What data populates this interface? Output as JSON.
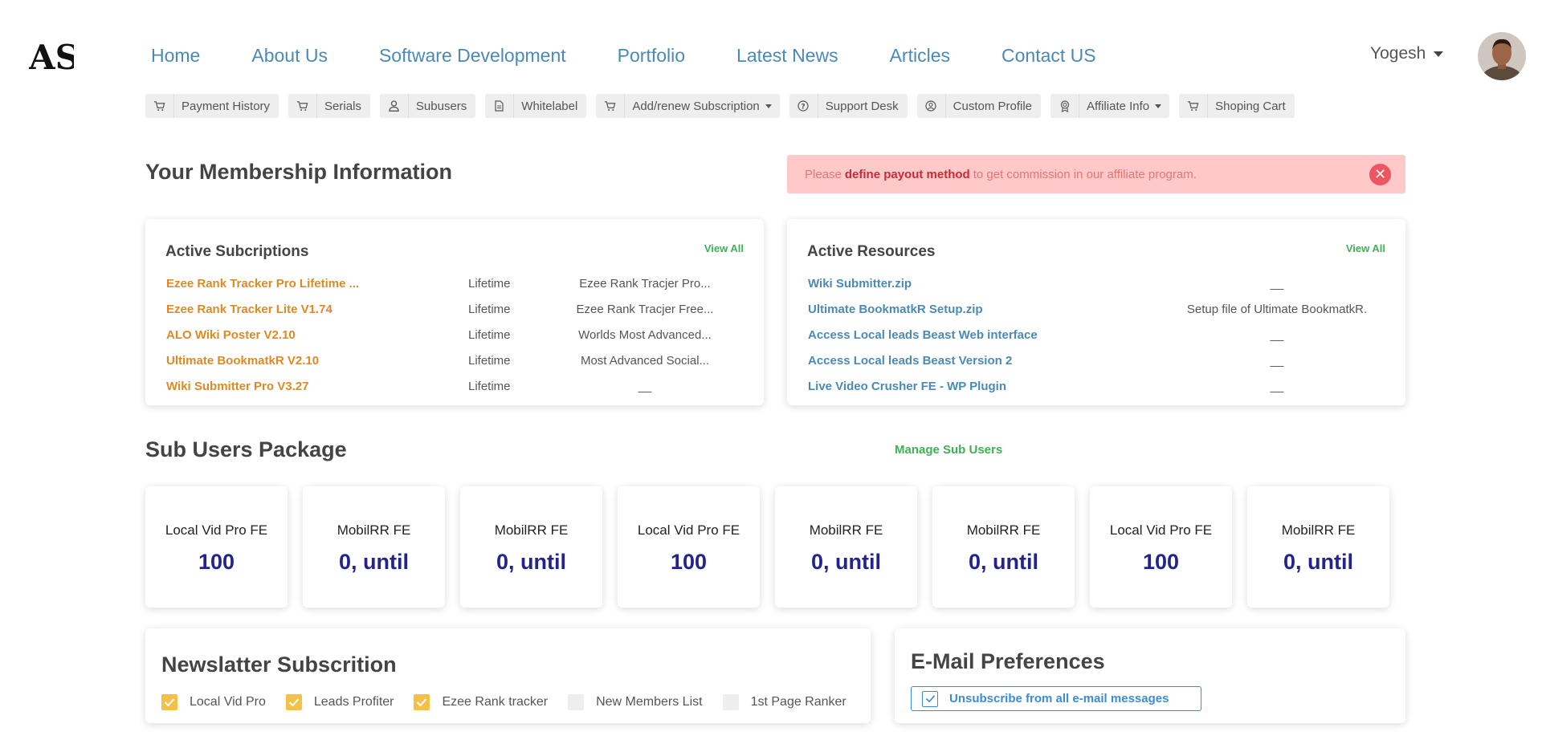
{
  "logo": {
    "text": "AS"
  },
  "nav": [
    "Home",
    "About Us",
    "Software Development",
    "Portfolio",
    "Latest News",
    "Articles",
    "Contact US"
  ],
  "user": {
    "name": "Yogesh"
  },
  "subnav": [
    {
      "label": "Payment History",
      "icon": "cart-icon"
    },
    {
      "label": "Serials",
      "icon": "cart-icon"
    },
    {
      "label": "Subusers",
      "icon": "user-icon"
    },
    {
      "label": "Whitelabel",
      "icon": "document-icon"
    },
    {
      "label": "Add/renew Subscription",
      "icon": "cart-icon",
      "dropdown": true
    },
    {
      "label": "Support Desk",
      "icon": "question-icon"
    },
    {
      "label": "Custom Profile",
      "icon": "profile-icon"
    },
    {
      "label": "Affiliate Info",
      "icon": "award-icon",
      "dropdown": true
    },
    {
      "label": "Shoping Cart",
      "icon": "cart-icon"
    }
  ],
  "membership": {
    "title": "Your Membership Information"
  },
  "alert": {
    "before": "Please",
    "bold": "define payout method",
    "after": "to get commission in our affiliate program."
  },
  "subscriptions": {
    "title": "Active Subcriptions",
    "view_all": "View All",
    "rows": [
      {
        "name": "Ezee Rank Tracker Pro Lifetime ...",
        "term": "Lifetime",
        "desc": "Ezee Rank Tracjer Pro..."
      },
      {
        "name": "Ezee Rank Tracker Lite V1.74",
        "term": "Lifetime",
        "desc": "Ezee Rank Tracjer Free..."
      },
      {
        "name": "ALO Wiki Poster V2.10",
        "term": "Lifetime",
        "desc": "Worlds Most Advanced..."
      },
      {
        "name": "Ultimate BookmatkR V2.10",
        "term": "Lifetime",
        "desc": "Most Advanced Social..."
      },
      {
        "name": "Wiki Submitter Pro V3.27",
        "term": "Lifetime",
        "desc": "__"
      }
    ]
  },
  "resources": {
    "title": "Active Resources",
    "view_all": "View All",
    "rows": [
      {
        "name": "Wiki Submitter.zip",
        "desc": "__"
      },
      {
        "name": "Ultimate BookmatkR Setup.zip",
        "desc": "Setup file of Ultimate BookmatkR."
      },
      {
        "name": "Access Local leads Beast Web interface",
        "desc": "__"
      },
      {
        "name": "Access Local leads Beast Version 2",
        "desc": "__"
      },
      {
        "name": "Live Video Crusher FE - WP Plugin",
        "desc": "__"
      }
    ]
  },
  "subusers": {
    "title": "Sub Users Package",
    "manage": "Manage Sub Users",
    "packages": [
      {
        "name": "Local Vid Pro FE",
        "value": "100"
      },
      {
        "name": "MobilRR FE",
        "value": "0, until"
      },
      {
        "name": "MobilRR FE",
        "value": "0, until"
      },
      {
        "name": "Local Vid Pro FE",
        "value": "100"
      },
      {
        "name": "MobilRR FE",
        "value": "0, until"
      },
      {
        "name": "MobilRR FE",
        "value": "0, until"
      },
      {
        "name": "Local Vid Pro FE",
        "value": "100"
      },
      {
        "name": "MobilRR FE",
        "value": "0, until"
      }
    ]
  },
  "newsletter": {
    "title": "Newslatter Subscrition",
    "items": [
      {
        "label": "Local Vid Pro",
        "checked": true
      },
      {
        "label": "Leads Profiter",
        "checked": true
      },
      {
        "label": "Ezee Rank tracker",
        "checked": true
      },
      {
        "label": "New Members List",
        "checked": false
      },
      {
        "label": "1st Page Ranker",
        "checked": false
      }
    ]
  },
  "email": {
    "title": "E-Mail Preferences",
    "unsubscribe": "Unsubscribe from all e-mail messages",
    "checked": true
  },
  "colors": {
    "link": "#4a8ab5",
    "orange": "#dc8a25",
    "green": "#40b054",
    "navy": "#232390",
    "alert_bg": "#ffc9c9",
    "check": "#f4c04a"
  }
}
